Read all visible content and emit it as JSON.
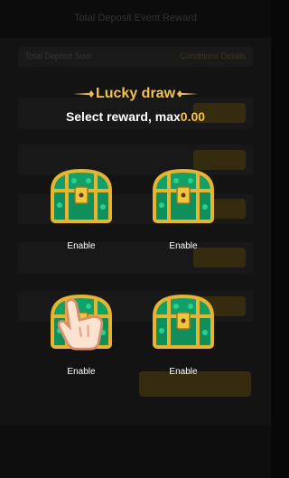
{
  "background": {
    "header_title": "Total Deposit Event Reward",
    "tab_left": "Total Deposit Sum",
    "tab_right": "Conditions Details"
  },
  "modal": {
    "title": "Lucky draw",
    "subtitle_prefix": "Select reward, max",
    "max_amount": "0.00"
  },
  "chests": [
    {
      "label": "Enable",
      "icon": "treasure-chest-icon"
    },
    {
      "label": "Enable",
      "icon": "treasure-chest-icon"
    },
    {
      "label": "Enable",
      "icon": "treasure-chest-icon"
    },
    {
      "label": "Enable",
      "icon": "treasure-chest-icon"
    }
  ],
  "colors": {
    "accent_gold": "#f3c24a",
    "chest_green": "#0f8f5a",
    "chest_frame": "#e6b430"
  }
}
